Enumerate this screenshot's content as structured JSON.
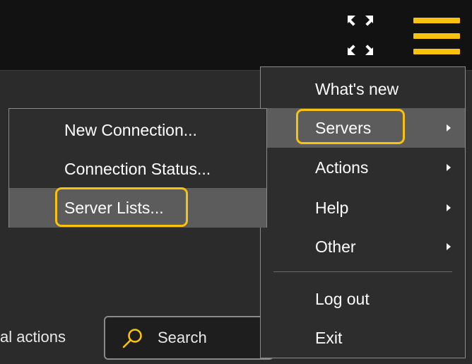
{
  "toolbar": {
    "expand_icon": "fullscreen-icon",
    "menu_icon": "hamburger-menu-icon",
    "accent_color": "#f9c20f"
  },
  "background": {
    "actions_label": "al actions",
    "search": {
      "label": "Search",
      "icon": "search-icon"
    }
  },
  "main_menu": {
    "items": [
      {
        "label": "What's new",
        "has_submenu": false
      },
      {
        "label": "Servers",
        "has_submenu": true,
        "active": true,
        "highlighted": true
      },
      {
        "label": "Actions",
        "has_submenu": true
      },
      {
        "label": "Help",
        "has_submenu": true
      },
      {
        "label": "Other",
        "has_submenu": true
      },
      {
        "label": "Log out",
        "has_submenu": false
      },
      {
        "label": "Exit",
        "has_submenu": false
      }
    ]
  },
  "servers_submenu": {
    "items": [
      {
        "label": "New Connection..."
      },
      {
        "label": "Connection Status..."
      },
      {
        "label": "Server Lists...",
        "active": true,
        "highlighted": true
      }
    ]
  }
}
